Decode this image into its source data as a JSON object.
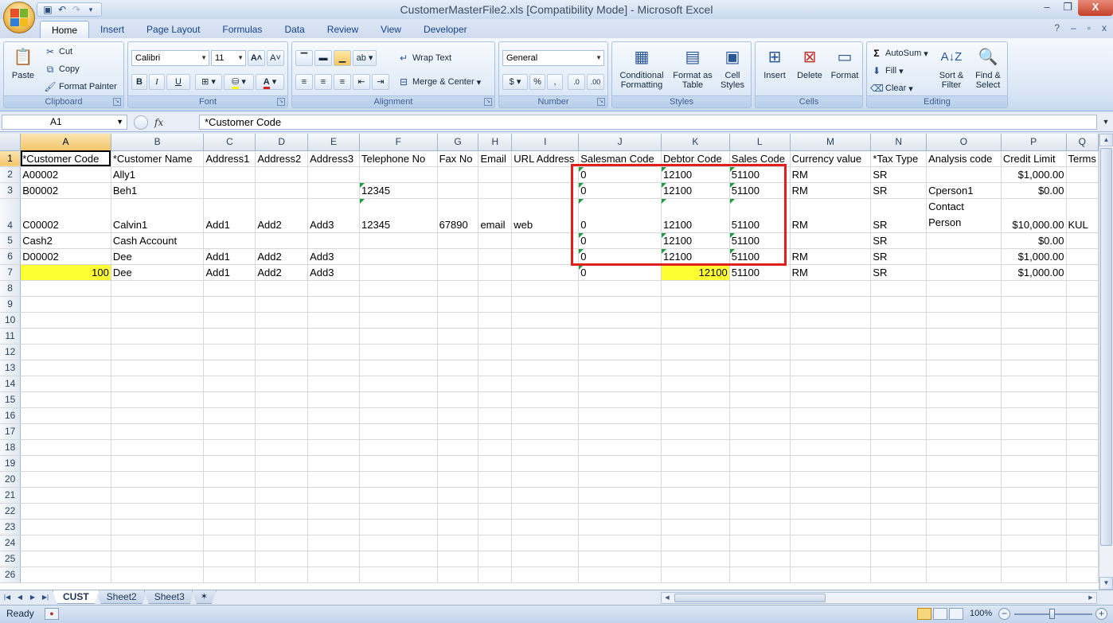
{
  "window": {
    "title": "CustomerMasterFile2.xls  [Compatibility Mode] - Microsoft Excel",
    "minimize": "–",
    "restore": "❐",
    "close": "X"
  },
  "ribbon_tabs": [
    "Home",
    "Insert",
    "Page Layout",
    "Formulas",
    "Data",
    "Review",
    "View",
    "Developer"
  ],
  "active_tab": "Home",
  "help_controls": [
    "?",
    "–",
    "▫",
    "x"
  ],
  "clipboard": {
    "label": "Clipboard",
    "paste": "Paste",
    "cut": "Cut",
    "copy": "Copy",
    "format_painter": "Format Painter"
  },
  "font": {
    "label": "Font",
    "name": "Calibri",
    "size": "11",
    "bold": "B",
    "italic": "I",
    "underline": "U",
    "grow": "A˄",
    "shrink": "A˅",
    "font_color": "A"
  },
  "alignment": {
    "label": "Alignment",
    "wrap_text": "Wrap Text",
    "merge_center": "Merge & Center"
  },
  "number": {
    "label": "Number",
    "format": "General",
    "percent": "%",
    "comma": ","
  },
  "styles": {
    "label": "Styles",
    "conditional_formatting": "Conditional Formatting",
    "format_as_table": "Format as Table",
    "cell_styles": "Cell Styles"
  },
  "cells": {
    "label": "Cells",
    "insert": "Insert",
    "delete": "Delete",
    "format": "Format"
  },
  "editing": {
    "label": "Editing",
    "autosum": "AutoSum",
    "fill": "Fill",
    "clear": "Clear",
    "sort_filter": "Sort & Filter",
    "find_select": "Find & Select"
  },
  "formula_bar": {
    "name_box": "A1",
    "fx": "fx",
    "content": "*Customer Code"
  },
  "grid": {
    "columns": [
      "A",
      "B",
      "C",
      "D",
      "E",
      "F",
      "G",
      "H",
      "I",
      "J",
      "K",
      "L",
      "M",
      "N",
      "O",
      "P",
      "Q"
    ],
    "rows": [
      [
        "*Customer Code",
        "*Customer Name",
        "Address1",
        "Address2",
        "Address3",
        "Telephone No",
        "Fax No",
        "Email",
        "URL Address",
        "Salesman Code",
        "Debtor Code",
        "Sales Code",
        "Currency value",
        "*Tax Type",
        "Analysis code",
        "Credit Limit",
        "Terms"
      ],
      [
        "A00002",
        "Ally1",
        "",
        "",
        "",
        "",
        "",
        "",
        "",
        "0",
        "12100",
        "51100",
        "RM",
        "SR",
        "",
        "$1,000.00",
        ""
      ],
      [
        "B00002",
        "Beh1",
        "",
        "",
        "",
        "12345",
        "",
        "",
        "",
        "0",
        "12100",
        "51100",
        "RM",
        "SR",
        "Cperson1",
        "$0.00",
        ""
      ],
      [
        "C00002",
        "Calvin1",
        "Add1",
        "Add2",
        "Add3",
        "12345",
        "67890",
        "email",
        "web",
        "0",
        "12100",
        "51100",
        "RM",
        "SR",
        "Contact Person",
        "$10,000.00",
        "KUL"
      ],
      [
        "Cash2",
        "Cash Account",
        "",
        "",
        "",
        "",
        "",
        "",
        "",
        "0",
        "12100",
        "51100",
        "",
        "SR",
        "",
        "$0.00",
        ""
      ],
      [
        "D00002",
        "Dee",
        "Add1",
        "Add2",
        "Add3",
        "",
        "",
        "",
        "",
        "0",
        "12100",
        "51100",
        "RM",
        "SR",
        "",
        "$1,000.00",
        ""
      ],
      [
        "100",
        "Dee",
        "Add1",
        "Add2",
        "Add3",
        "",
        "",
        "",
        "",
        "0",
        "12100",
        "51100",
        "RM",
        "SR",
        "",
        "$1,000.00",
        ""
      ]
    ],
    "total_rows": 26
  },
  "sheet_tabs": [
    "CUST",
    "Sheet2",
    "Sheet3"
  ],
  "active_sheet": "CUST",
  "status": {
    "text": "Ready",
    "zoom": "100%",
    "zoom_minus": "−",
    "zoom_plus": "+"
  },
  "colors": {
    "highlight_yellow": "#ffff33",
    "annotation_red": "#e0201b",
    "selected_header": "#f3c56a",
    "error_triangle": "#1d9b3d"
  }
}
